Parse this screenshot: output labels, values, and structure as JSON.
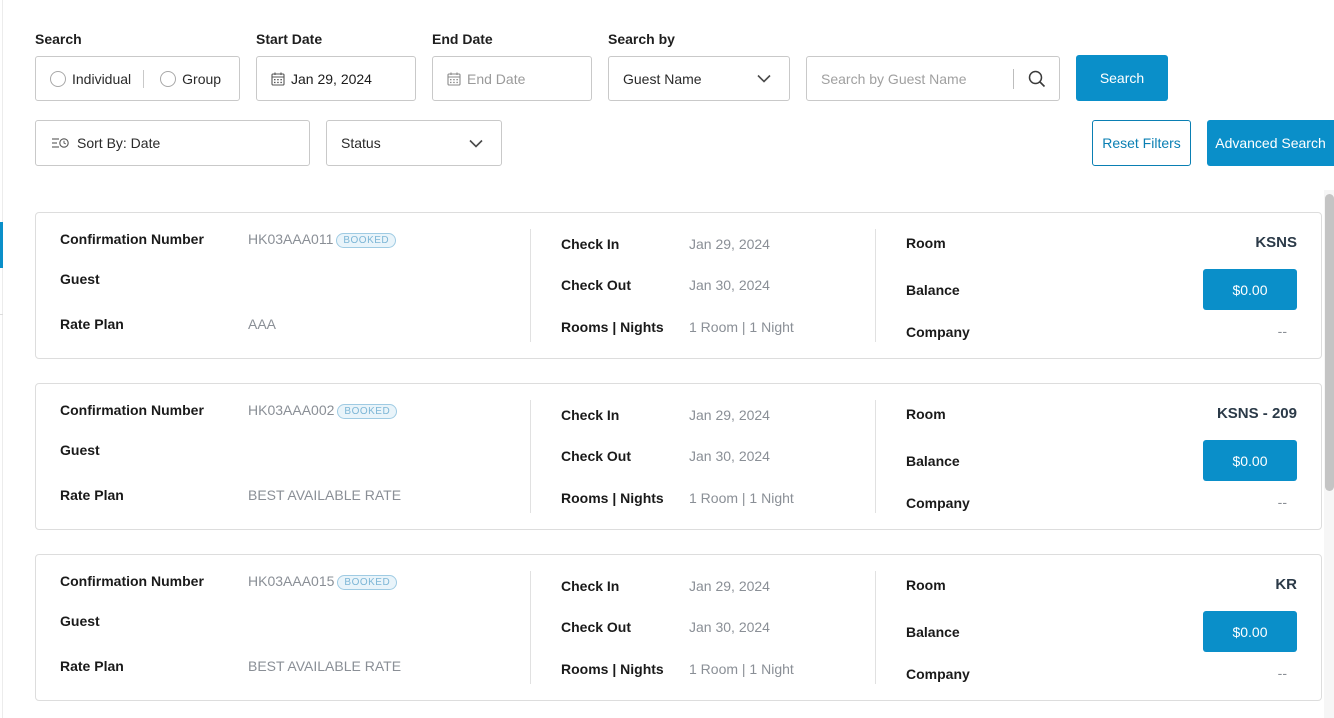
{
  "filters": {
    "search_label": "Search",
    "individual_label": "Individual",
    "group_label": "Group",
    "start_date_label": "Start Date",
    "start_date_value": "Jan 29, 2024",
    "end_date_label": "End Date",
    "end_date_placeholder": "End Date",
    "search_by_label": "Search by",
    "search_by_value": "Guest Name",
    "search_placeholder": "Search by Guest Name",
    "search_button": "Search",
    "sort_label": "Sort By: Date",
    "status_label": "Status",
    "reset_button": "Reset Filters",
    "advanced_button": "Advanced Search"
  },
  "card_labels": {
    "confirmation": "Confirmation Number",
    "guest": "Guest",
    "rate_plan": "Rate Plan",
    "check_in": "Check In",
    "check_out": "Check Out",
    "rooms_nights": "Rooms | Nights",
    "room": "Room",
    "balance": "Balance",
    "company": "Company"
  },
  "reservations": [
    {
      "confirmation": "HK03AAA011",
      "status": "BOOKED",
      "guest": "",
      "rate_plan": "AAA",
      "check_in": "Jan 29, 2024",
      "check_out": "Jan 30, 2024",
      "rooms_nights": "1 Room | 1 Night",
      "room": "KSNS",
      "balance": "$0.00",
      "company": "--"
    },
    {
      "confirmation": "HK03AAA002",
      "status": "BOOKED",
      "guest": "",
      "rate_plan": "BEST AVAILABLE RATE",
      "check_in": "Jan 29, 2024",
      "check_out": "Jan 30, 2024",
      "rooms_nights": "1 Room | 1 Night",
      "room": "KSNS - 209",
      "balance": "$0.00",
      "company": "--"
    },
    {
      "confirmation": "HK03AAA015",
      "status": "BOOKED",
      "guest": "",
      "rate_plan": "BEST AVAILABLE RATE",
      "check_in": "Jan 29, 2024",
      "check_out": "Jan 30, 2024",
      "rooms_nights": "1 Room | 1 Night",
      "room": "KR",
      "balance": "$0.00",
      "company": "--"
    }
  ]
}
